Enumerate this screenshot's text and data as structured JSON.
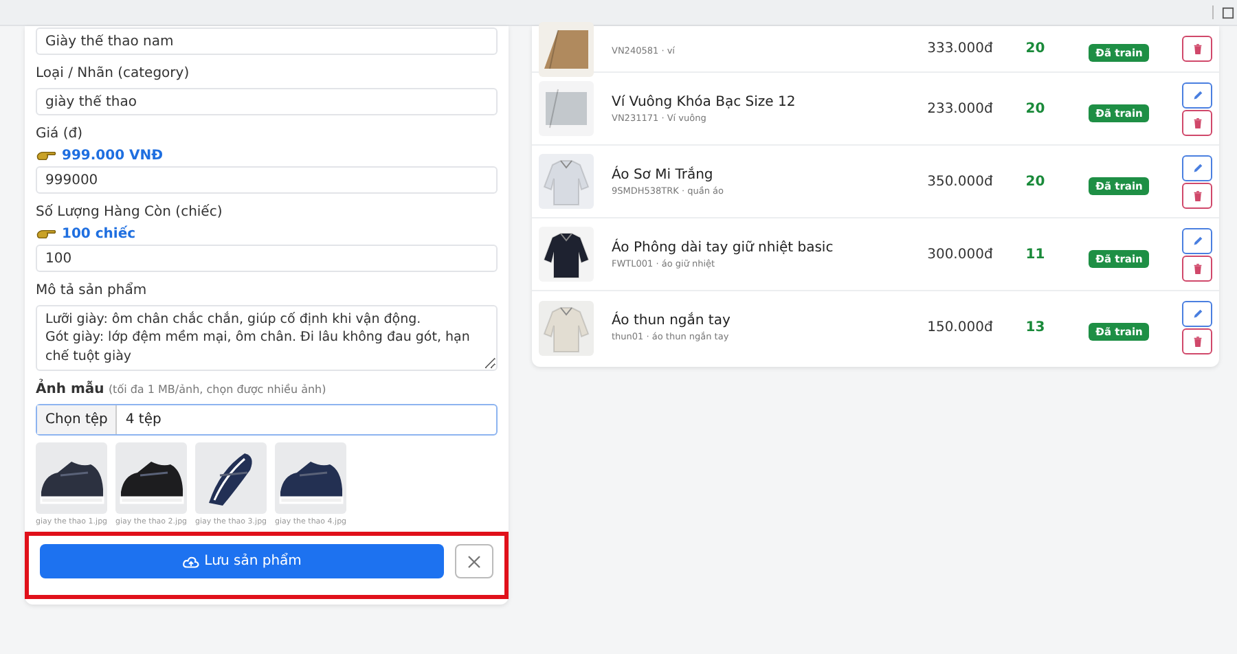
{
  "form": {
    "fields": [
      {
        "kind": "input",
        "value": "Giày thể thao nam"
      },
      {
        "kind": "input",
        "label": "Loại / Nhãn (category)",
        "value": "giày thể thao"
      },
      {
        "kind": "input",
        "label": "Giá (đ)",
        "hint": "999.000 VNĐ",
        "value": "999000"
      },
      {
        "kind": "input",
        "label": "Số Lượng Hàng Còn (chiếc)",
        "hint": "100 chiếc",
        "value": "100"
      },
      {
        "kind": "textarea",
        "label": "Mô tả sản phẩm",
        "value": "Lưỡi giày: ôm chân chắc chắn, giúp cố định khi vận động.\nGót giày: lớp đệm mềm mại, ôm chân. Đi lâu không đau gót, hạn chế tuột giày"
      }
    ],
    "images": {
      "label": "Ảnh mẫu",
      "note": "(tối đa 1 MB/ảnh, chọn được nhiều ảnh)",
      "button": "Chọn tệp",
      "value": "4 tệp",
      "files": [
        {
          "name": "giay the thao 1.jpg"
        },
        {
          "name": "giay the thao 2.jpg"
        },
        {
          "name": "giay the thao 3.jpg"
        },
        {
          "name": "giay the thao 4.jpg"
        }
      ]
    },
    "actions": {
      "highlighted": true,
      "save": "Lưu sản phẩm"
    }
  },
  "products": [
    {
      "meta": "VN240581 · ví",
      "price": "333.000đ",
      "stock": "20",
      "status": "Đã train",
      "actions": [
        {
          "kind": "delete"
        }
      ]
    },
    {
      "name": "Ví Vuông Khóa Bạc Size 12",
      "meta": "VN231171 · Ví vuông",
      "price": "233.000đ",
      "stock": "20",
      "status": "Đã train",
      "actions": [
        {
          "kind": "edit"
        },
        {
          "kind": "delete"
        }
      ]
    },
    {
      "name": "Áo Sơ Mi Trắng",
      "meta": "9SMDH538TRK · quần áo",
      "price": "350.000đ",
      "stock": "20",
      "status": "Đã train",
      "actions": [
        {
          "kind": "edit"
        },
        {
          "kind": "delete"
        }
      ]
    },
    {
      "name": "Áo Phông dài tay giữ nhiệt basic",
      "meta": "FWTL001 · áo giữ nhiệt",
      "price": "300.000đ",
      "stock": "11",
      "status": "Đã train",
      "actions": [
        {
          "kind": "edit"
        },
        {
          "kind": "delete"
        }
      ]
    },
    {
      "name": "Áo thun ngắn tay",
      "meta": "thun01 · áo thun ngắn tay",
      "price": "150.000đ",
      "stock": "13",
      "status": "Đã train",
      "actions": [
        {
          "kind": "edit"
        },
        {
          "kind": "delete"
        }
      ]
    }
  ]
}
